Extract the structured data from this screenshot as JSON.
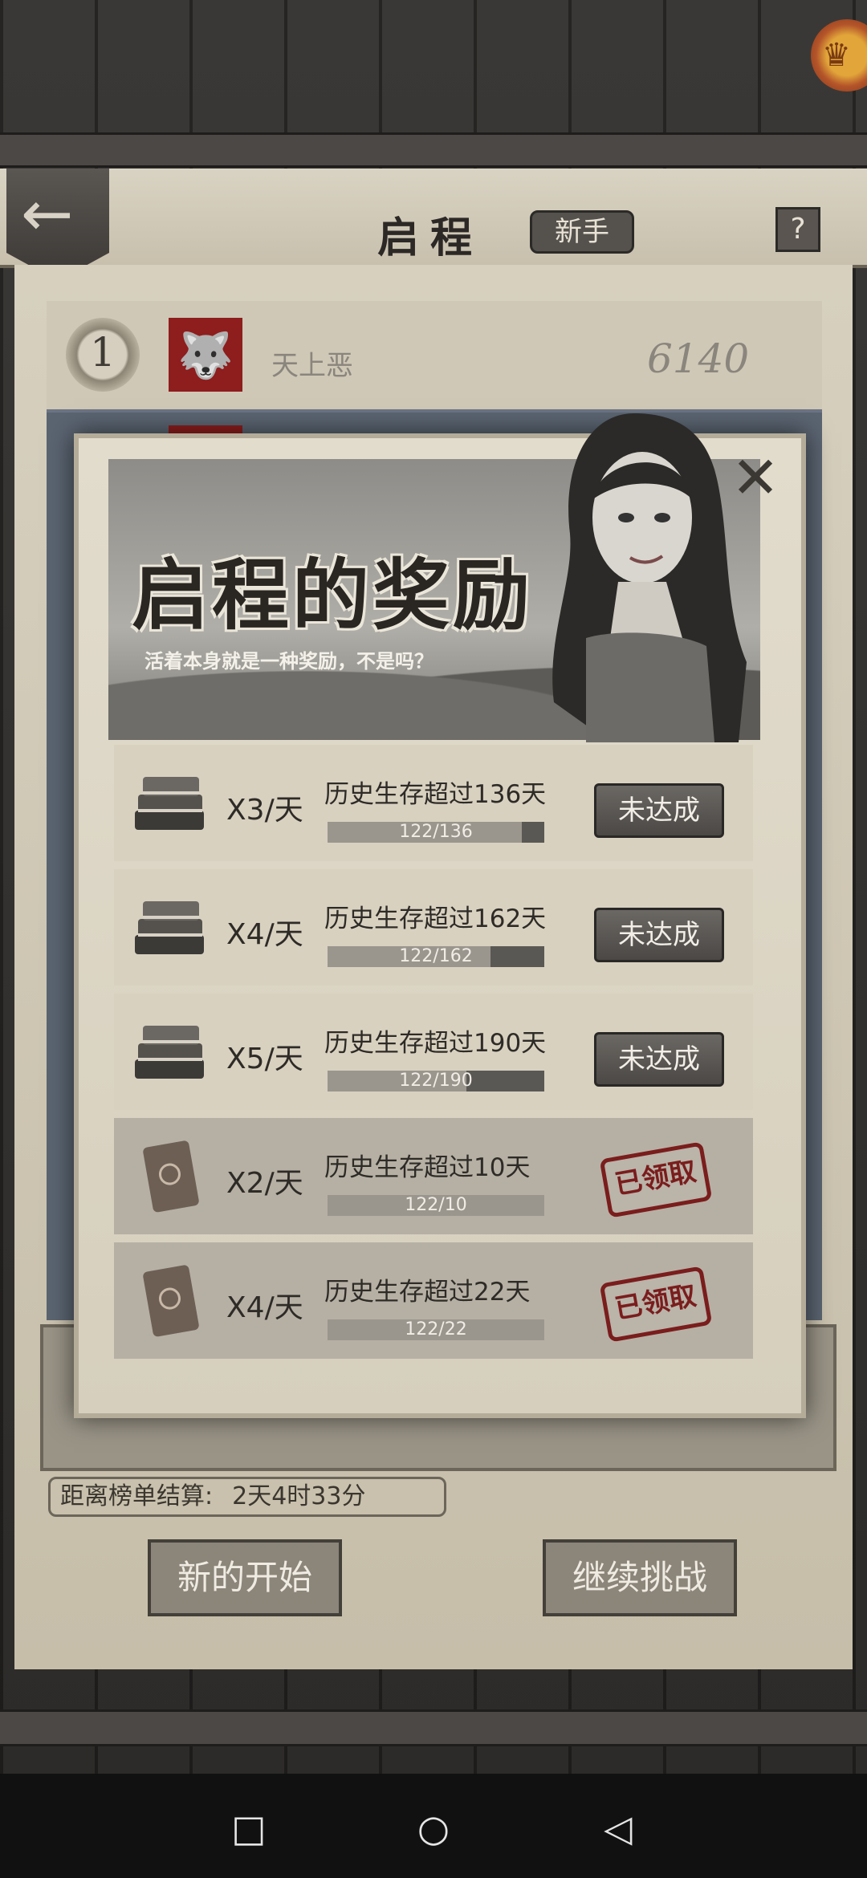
{
  "header": {
    "title": "启程",
    "mode_badge": "新手",
    "help": "?"
  },
  "leaderboard": {
    "top_entry": {
      "rank": "1",
      "name": "天上恶",
      "score": "6140"
    }
  },
  "footer": {
    "countdown_label": "距离榜单结算:",
    "countdown_value": "2天4时33分",
    "new_start_label": "新的开始",
    "continue_label": "继续挑战"
  },
  "modal": {
    "title": "启程的奖励",
    "subtitle": "活着本身就是一种奖励，不是吗？",
    "rewards": [
      {
        "multiplier": "X3/天",
        "requirement": "历史生存超过136天",
        "progress_text": "122/136",
        "progress": 0.897,
        "status": "未达成",
        "icon": "books-stack-icon"
      },
      {
        "multiplier": "X4/天",
        "requirement": "历史生存超过162天",
        "progress_text": "122/162",
        "progress": 0.753,
        "status": "未达成",
        "icon": "books-stack-icon"
      },
      {
        "multiplier": "X5/天",
        "requirement": "历史生存超过190天",
        "progress_text": "122/190",
        "progress": 0.642,
        "status": "未达成",
        "icon": "books-stack-icon"
      },
      {
        "multiplier": "X2/天",
        "requirement": "历史生存超过10天",
        "progress_text": "122/10",
        "progress": 1.0,
        "status": "已领取",
        "icon": "old-book-icon"
      },
      {
        "multiplier": "X4/天",
        "requirement": "历史生存超过22天",
        "progress_text": "122/22",
        "progress": 1.0,
        "status": "已领取",
        "icon": "old-book-icon"
      }
    ]
  },
  "nav": {
    "square": "□",
    "circle": "○",
    "back": "◁"
  },
  "colors": {
    "stamp": "#7a1d1d",
    "parchment": "#d8d1c0",
    "board_blue": "#5b6572"
  }
}
